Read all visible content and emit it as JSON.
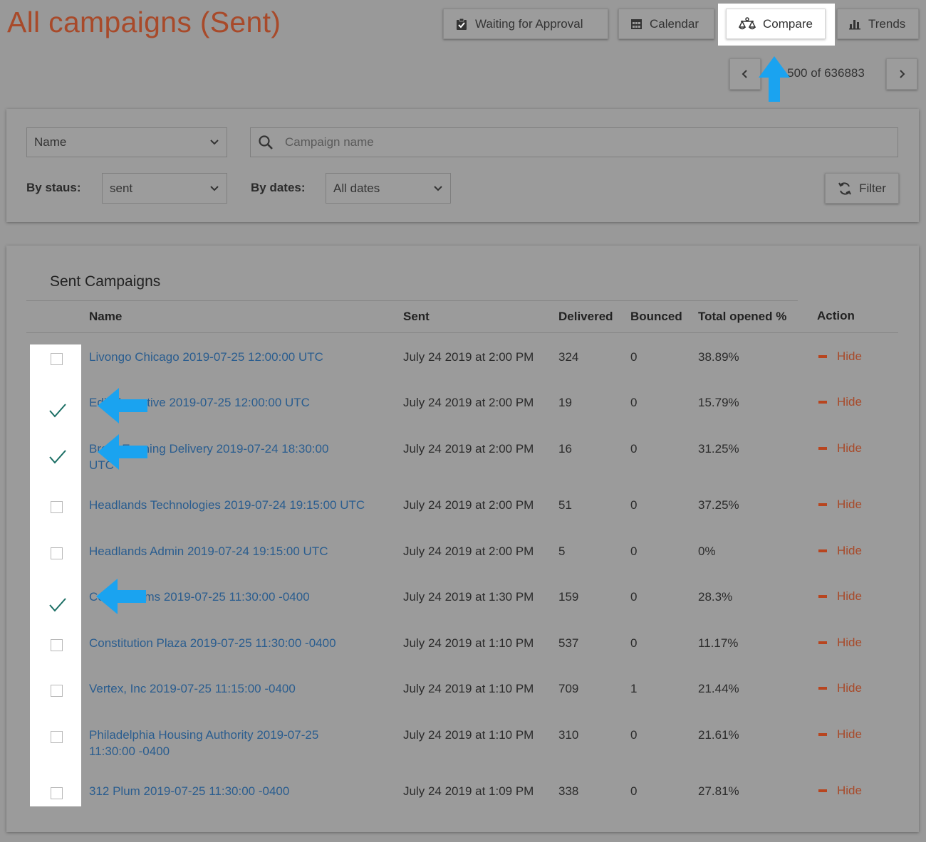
{
  "header": {
    "title": "All campaigns (Sent)",
    "buttons": {
      "waiting": "Waiting for Approval",
      "calendar": "Calendar",
      "compare": "Compare",
      "trends": "Trends"
    }
  },
  "pager": {
    "text": "1-500 of 636883"
  },
  "filters": {
    "field_select": "Name",
    "search_placeholder": "Campaign name",
    "status_label": "By staus:",
    "status_value": "sent",
    "dates_label": "By dates:",
    "dates_value": "All dates",
    "filter_button": "Filter"
  },
  "table": {
    "title": "Sent Campaigns",
    "columns": [
      "Name",
      "Sent",
      "Delivered",
      "Bounced",
      "Total opened %",
      "Action"
    ],
    "action_label": "Hide",
    "rows": [
      {
        "checked": false,
        "name_l1": "Livongo Chicago 2019-07-25 12:00:00 UTC",
        "name_l2": "",
        "sent": "July 24 2019 at 2:00 PM",
        "delivered": "324",
        "bounced": "0",
        "opened": "38.89%"
      },
      {
        "checked": true,
        "name_l1": "Edit Executive 2019-07-25 12:00:00 UTC",
        "name_l2": "",
        "sent": "July 24 2019 at 2:00 PM",
        "delivered": "19",
        "bounced": "0",
        "opened": "15.79%"
      },
      {
        "checked": true,
        "name_l1": "Brera Evening Delivery 2019-07-24 18:30:00",
        "name_l2": "UTC",
        "sent": "July 24 2019 at 2:00 PM",
        "delivered": "16",
        "bounced": "0",
        "opened": "31.25%"
      },
      {
        "checked": false,
        "name_l1": "Headlands Technologies 2019-07-24 19:15:00 UTC",
        "name_l2": "",
        "sent": "July 24 2019 at 2:00 PM",
        "delivered": "51",
        "bounced": "0",
        "opened": "37.25%"
      },
      {
        "checked": false,
        "name_l1": "Headlands Admin 2019-07-24 19:15:00 UTC",
        "name_l2": "",
        "sent": "July 24 2019 at 2:00 PM",
        "delivered": "5",
        "bounced": "0",
        "opened": "0%"
      },
      {
        "checked": true,
        "name_l1": "Cosmo Items 2019-07-25 11:30:00 -0400",
        "name_l2": "",
        "sent": "July 24 2019 at 1:30 PM",
        "delivered": "159",
        "bounced": "0",
        "opened": "28.3%"
      },
      {
        "checked": false,
        "name_l1": "Constitution Plaza 2019-07-25 11:30:00 -0400",
        "name_l2": "",
        "sent": "July 24 2019 at 1:10 PM",
        "delivered": "537",
        "bounced": "0",
        "opened": "11.17%"
      },
      {
        "checked": false,
        "name_l1": "Vertex, Inc 2019-07-25 11:15:00 -0400",
        "name_l2": "",
        "sent": "July 24 2019 at 1:10 PM",
        "delivered": "709",
        "bounced": "1",
        "opened": "21.44%"
      },
      {
        "checked": false,
        "name_l1": "Philadelphia Housing Authority 2019-07-25",
        "name_l2": "11:30:00 -0400",
        "sent": "July 24 2019 at 1:10 PM",
        "delivered": "310",
        "bounced": "0",
        "opened": "21.61%"
      },
      {
        "checked": false,
        "name_l1": "312 Plum 2019-07-25 11:30:00 -0400",
        "name_l2": "",
        "sent": "July 24 2019 at 1:09 PM",
        "delivered": "338",
        "bounced": "0",
        "opened": "27.81%"
      }
    ]
  },
  "colors": {
    "accent": "#a84a2a",
    "link": "#2a5d8f",
    "check": "#1a6e64",
    "annotation_arrow": "#1aa3f0",
    "overlay": "#999999"
  }
}
